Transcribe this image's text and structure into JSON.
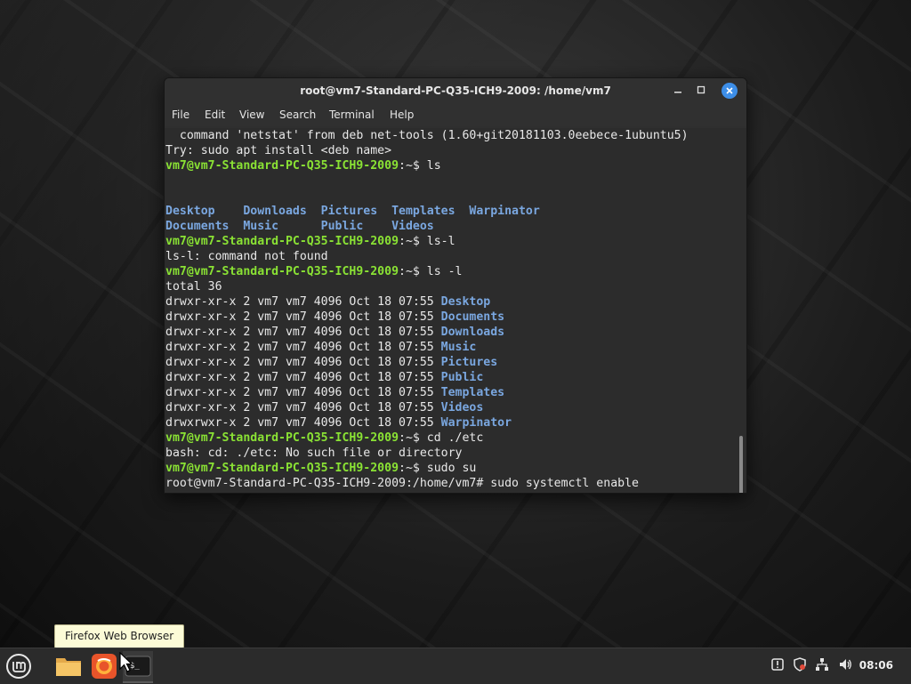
{
  "window": {
    "title": "root@vm7-Standard-PC-Q35-ICH9-2009: /home/vm7",
    "minimize_icon": "minimize-icon",
    "maximize_icon": "maximize-icon",
    "close_icon": "close-icon"
  },
  "menu": [
    {
      "label": "File"
    },
    {
      "label": "Edit"
    },
    {
      "label": "View"
    },
    {
      "label": "Search"
    },
    {
      "label": "Terminal"
    },
    {
      "label": "Help"
    }
  ],
  "terminal": {
    "colors": {
      "prompt": "#8ae234",
      "directory": "#7aa7e0",
      "text": "#e8e8e8",
      "background": "#2c2c2c"
    },
    "lines": [
      {
        "text": "  command 'netstat' from deb net-tools (1.60+git20181103.0eebece-1ubuntu5)"
      },
      {
        "text": "Try: sudo apt install <deb name>"
      },
      {
        "prompt": "vm7@vm7-Standard-PC-Q35-ICH9-2009",
        "path": ":~$ ",
        "cmd": "ls"
      },
      {
        "text": ""
      },
      {
        "text": ""
      },
      {
        "dirs": "Desktop    Downloads  Pictures  Templates  Warpinator"
      },
      {
        "dirs": "Documents  Music      Public    Videos"
      },
      {
        "prompt": "vm7@vm7-Standard-PC-Q35-ICH9-2009",
        "path": ":~$ ",
        "cmd": "ls-l"
      },
      {
        "text": "ls-l: command not found"
      },
      {
        "prompt": "vm7@vm7-Standard-PC-Q35-ICH9-2009",
        "path": ":~$ ",
        "cmd": "ls -l"
      },
      {
        "text": "total 36"
      },
      {
        "perm": "drwxr-xr-x 2 vm7 vm7 4096 Oct 18 07:55 ",
        "name": "Desktop"
      },
      {
        "perm": "drwxr-xr-x 2 vm7 vm7 4096 Oct 18 07:55 ",
        "name": "Documents"
      },
      {
        "perm": "drwxr-xr-x 2 vm7 vm7 4096 Oct 18 07:55 ",
        "name": "Downloads"
      },
      {
        "perm": "drwxr-xr-x 2 vm7 vm7 4096 Oct 18 07:55 ",
        "name": "Music"
      },
      {
        "perm": "drwxr-xr-x 2 vm7 vm7 4096 Oct 18 07:55 ",
        "name": "Pictures"
      },
      {
        "perm": "drwxr-xr-x 2 vm7 vm7 4096 Oct 18 07:55 ",
        "name": "Public"
      },
      {
        "perm": "drwxr-xr-x 2 vm7 vm7 4096 Oct 18 07:55 ",
        "name": "Templates"
      },
      {
        "perm": "drwxr-xr-x 2 vm7 vm7 4096 Oct 18 07:55 ",
        "name": "Videos"
      },
      {
        "perm": "drwxrwxr-x 2 vm7 vm7 4096 Oct 18 07:55 ",
        "name": "Warpinator"
      },
      {
        "prompt": "vm7@vm7-Standard-PC-Q35-ICH9-2009",
        "path": ":~$ ",
        "cmd": "cd ./etc"
      },
      {
        "text": "bash: cd: ./etc: No such file or directory"
      },
      {
        "prompt": "vm7@vm7-Standard-PC-Q35-ICH9-2009",
        "path": ":~$ ",
        "cmd": "sudo su"
      },
      {
        "text": "root@vm7-Standard-PC-Q35-ICH9-2009:/home/vm7# sudo systemctl enable"
      }
    ]
  },
  "tooltip": {
    "text": "Firefox Web Browser"
  },
  "taskbar": {
    "menu_icon": "mint-menu-icon",
    "launchers": [
      {
        "icon": "folder-icon",
        "label": "Files"
      },
      {
        "icon": "firefox-icon",
        "label": "Firefox Web Browser"
      },
      {
        "icon": "terminal-icon",
        "label": "Terminal",
        "glyph": "$_"
      }
    ],
    "tray_icons": [
      "notifications-icon",
      "update-shield-icon",
      "network-icon",
      "volume-icon"
    ],
    "clock": "08:06"
  }
}
